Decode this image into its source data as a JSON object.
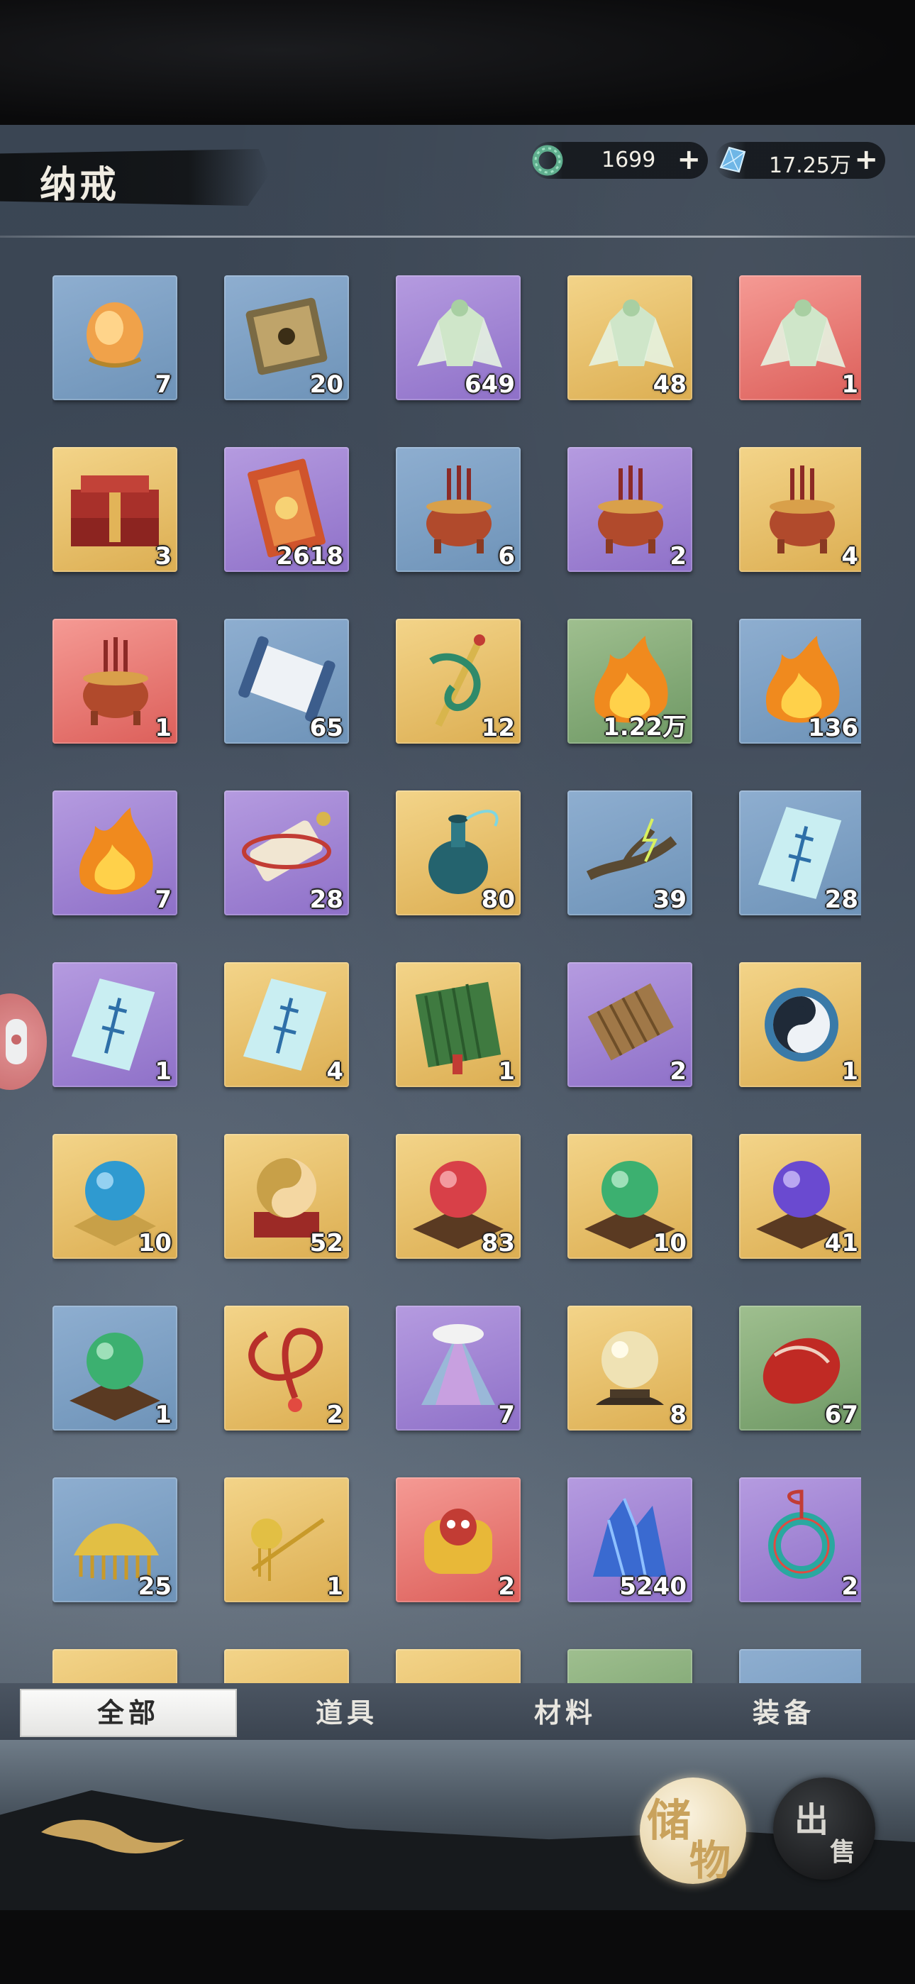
{
  "header": {
    "title": "纳戒",
    "currencies": [
      {
        "icon": "jade-ring-icon",
        "value": "1699"
      },
      {
        "icon": "blue-crystal-icon",
        "value": "17.25万"
      }
    ],
    "add_label": "+"
  },
  "items": [
    {
      "rarity": "blue",
      "icon": "amber-egg-icon",
      "count": "7"
    },
    {
      "rarity": "blue",
      "icon": "treasure-tome-icon",
      "count": "20"
    },
    {
      "rarity": "purple",
      "icon": "jade-cicada-icon",
      "count": "649"
    },
    {
      "rarity": "gold",
      "icon": "jade-cicada-icon",
      "count": "48"
    },
    {
      "rarity": "red",
      "icon": "jade-cicada-icon",
      "count": "1"
    },
    {
      "rarity": "gold",
      "icon": "red-chest-icon",
      "count": "3"
    },
    {
      "rarity": "purple",
      "icon": "red-talisman-icon",
      "count": "2618"
    },
    {
      "rarity": "blue",
      "icon": "incense-burner-icon",
      "count": "6"
    },
    {
      "rarity": "purple",
      "icon": "incense-burner-icon",
      "count": "2"
    },
    {
      "rarity": "gold",
      "icon": "incense-burner-icon",
      "count": "4"
    },
    {
      "rarity": "red",
      "icon": "incense-burner-icon",
      "count": "1"
    },
    {
      "rarity": "blue",
      "icon": "scroll-icon",
      "count": "65"
    },
    {
      "rarity": "gold",
      "icon": "dragon-sword-icon",
      "count": "12"
    },
    {
      "rarity": "green",
      "icon": "flame-icon",
      "count": "1.22万"
    },
    {
      "rarity": "blue",
      "icon": "flame-icon",
      "count": "136"
    },
    {
      "rarity": "purple",
      "icon": "flame-icon",
      "count": "7"
    },
    {
      "rarity": "purple",
      "icon": "scroll-bundle-icon",
      "count": "28"
    },
    {
      "rarity": "gold",
      "icon": "teal-vase-icon",
      "count": "80"
    },
    {
      "rarity": "blue",
      "icon": "lightning-branch-icon",
      "count": "39"
    },
    {
      "rarity": "blue",
      "icon": "paper-talisman-icon",
      "count": "28"
    },
    {
      "rarity": "purple",
      "icon": "paper-talisman-icon",
      "count": "1"
    },
    {
      "rarity": "gold",
      "icon": "paper-talisman-icon",
      "count": "4"
    },
    {
      "rarity": "gold",
      "icon": "bamboo-book-icon",
      "count": "1"
    },
    {
      "rarity": "purple",
      "icon": "bamboo-scroll-icon",
      "count": "2"
    },
    {
      "rarity": "gold",
      "icon": "taiji-compass-icon",
      "count": "1"
    },
    {
      "rarity": "gold",
      "icon": "blue-orb-icon",
      "count": "10"
    },
    {
      "rarity": "gold",
      "icon": "taiji-orb-icon",
      "count": "52"
    },
    {
      "rarity": "gold",
      "icon": "red-orb-icon",
      "count": "83"
    },
    {
      "rarity": "gold",
      "icon": "green-orb-icon",
      "count": "10"
    },
    {
      "rarity": "gold",
      "icon": "purple-orb-icon",
      "count": "41"
    },
    {
      "rarity": "blue",
      "icon": "green-orb-icon",
      "count": "1"
    },
    {
      "rarity": "gold",
      "icon": "red-cord-icon",
      "count": "2"
    },
    {
      "rarity": "purple",
      "icon": "feather-cloak-icon",
      "count": "7"
    },
    {
      "rarity": "gold",
      "icon": "crystal-ball-icon",
      "count": "8"
    },
    {
      "rarity": "green",
      "icon": "red-pouch-icon",
      "count": "67"
    },
    {
      "rarity": "blue",
      "icon": "golden-comb-icon",
      "count": "25"
    },
    {
      "rarity": "gold",
      "icon": "golden-hairpin-icon",
      "count": "1"
    },
    {
      "rarity": "red",
      "icon": "golden-lion-icon",
      "count": "2"
    },
    {
      "rarity": "purple",
      "icon": "blue-crystal-icon",
      "count": "5240"
    },
    {
      "rarity": "purple",
      "icon": "jade-pendant-icon",
      "count": "2"
    },
    {
      "rarity": "gold",
      "icon": "item-icon",
      "count": ""
    },
    {
      "rarity": "gold",
      "icon": "item-icon",
      "count": ""
    },
    {
      "rarity": "gold",
      "icon": "item-icon",
      "count": ""
    },
    {
      "rarity": "green",
      "icon": "item-icon",
      "count": ""
    },
    {
      "rarity": "blue",
      "icon": "item-icon",
      "count": ""
    }
  ],
  "tabs": [
    {
      "label": "全部",
      "active": true
    },
    {
      "label": "道具",
      "active": false
    },
    {
      "label": "材料",
      "active": false
    },
    {
      "label": "装备",
      "active": false
    }
  ],
  "actions": {
    "store": {
      "line1": "储",
      "line2": "物"
    },
    "sell": {
      "line1": "出",
      "line2": "售"
    }
  },
  "colors": {
    "blue": "#7e9fc4",
    "purple": "#a084d6",
    "gold": "#e8c06b",
    "red": "#e87a74",
    "green": "#86ab7a"
  }
}
